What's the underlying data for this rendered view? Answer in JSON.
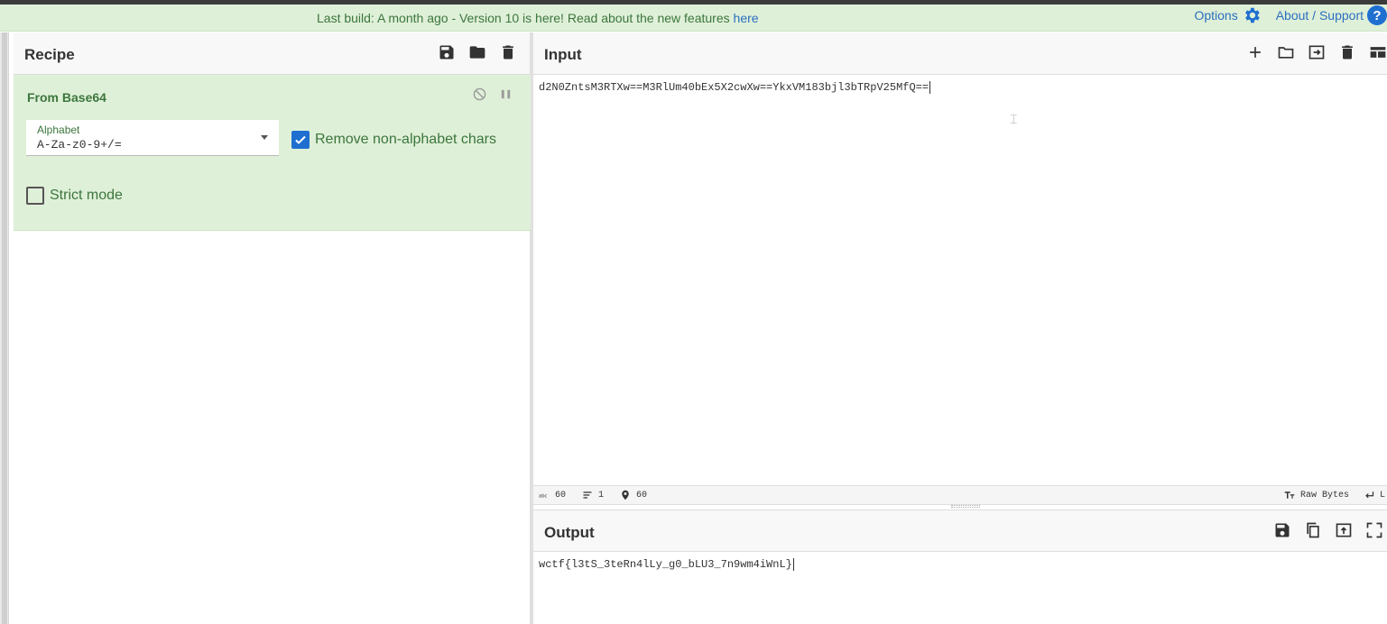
{
  "banner": {
    "text_prefix": "Last build: A month ago - Version 10 is here! Read about the new features ",
    "link": "here",
    "options_label": "Options",
    "about_label": "About / Support",
    "help_glyph": "?"
  },
  "recipe": {
    "title": "Recipe",
    "icons": [
      "save-icon",
      "folder-icon",
      "trash-icon"
    ],
    "operation": {
      "title": "From Base64",
      "alphabet_label": "Alphabet",
      "alphabet_value": "A-Za-z0-9+/=",
      "remove_non_alphabet_label": "Remove non-alphabet chars",
      "remove_non_alphabet_checked": true,
      "strict_mode_label": "Strict mode",
      "strict_mode_checked": false
    }
  },
  "input": {
    "title": "Input",
    "value": "d2N0ZntsM3RTXw==M3RlUm40bEx5X2cwXw==YkxVM183bjl3bTRpV25MfQ==",
    "icons": [
      "plus-icon",
      "open-folder-icon",
      "open-file-icon",
      "trash-icon",
      "layout-icon"
    ]
  },
  "status": {
    "chars": "60",
    "lines": "1",
    "position": "60",
    "encoding": "Raw Bytes",
    "eol": "L"
  },
  "output": {
    "title": "Output",
    "value": "wctf{l3tS_3teRn4lLy_g0_bLU3_7n9wm4iWnL}",
    "icons": [
      "save-icon",
      "copy-icon",
      "replace-input-icon",
      "maximize-icon"
    ]
  },
  "colors": {
    "banner_bg": "#dff0d8",
    "accent": "#1f6fd1",
    "green_text": "#3c763d"
  }
}
